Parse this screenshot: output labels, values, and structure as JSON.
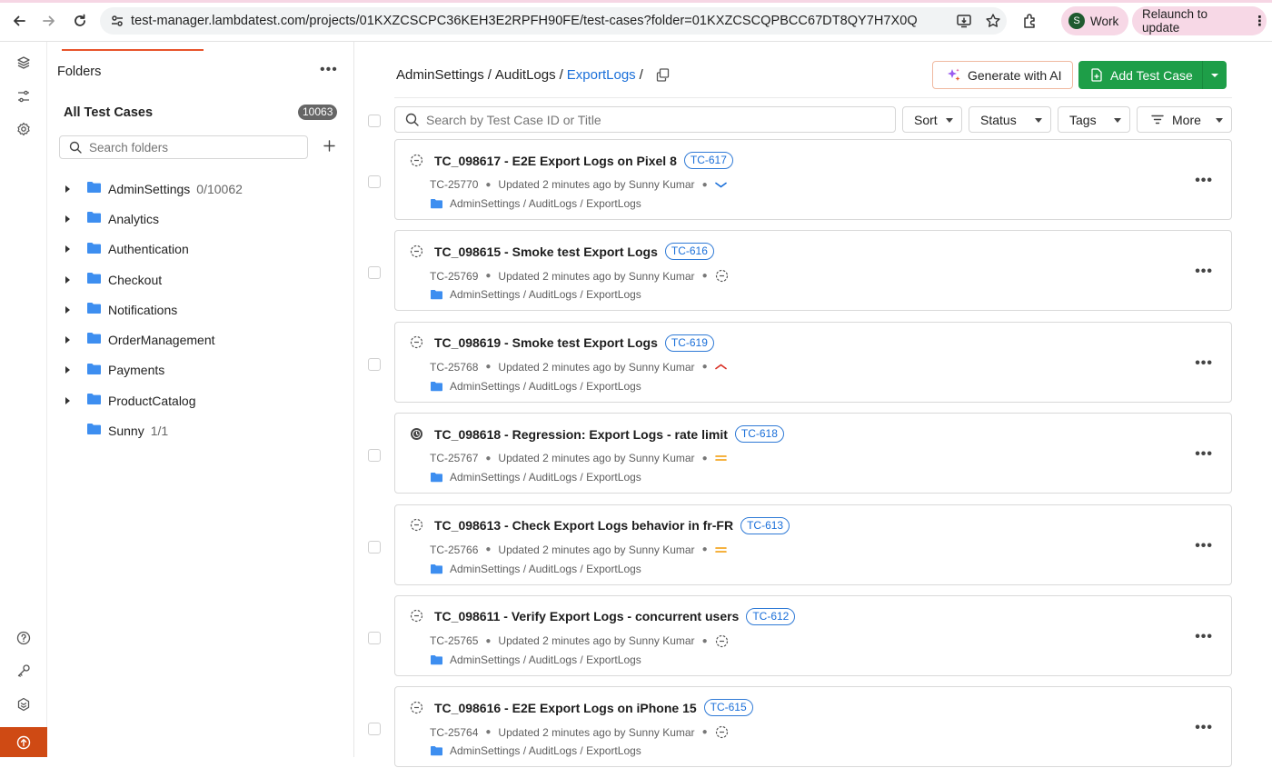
{
  "browser": {
    "url": "test-manager.lambdatest.com/projects/01KXZCSCPC36KEH3E2RPFH90FE/test-cases?folder=01KXZCSCQPBCC67DT8QY7H7X0Q",
    "profile_initial": "S",
    "profile_label": "Work",
    "relaunch_label": "Relaunch to update"
  },
  "folder_panel": {
    "title": "Folders",
    "all_test_cases_label": "All Test Cases",
    "all_test_cases_count": "10063",
    "search_placeholder": "Search folders",
    "folders": [
      {
        "name": "AdminSettings",
        "count": "0/10062",
        "expandable": true
      },
      {
        "name": "Analytics",
        "count": "",
        "expandable": true
      },
      {
        "name": "Authentication",
        "count": "",
        "expandable": true
      },
      {
        "name": "Checkout",
        "count": "",
        "expandable": true
      },
      {
        "name": "Notifications",
        "count": "",
        "expandable": true
      },
      {
        "name": "OrderManagement",
        "count": "",
        "expandable": true
      },
      {
        "name": "Payments",
        "count": "",
        "expandable": true
      },
      {
        "name": "ProductCatalog",
        "count": "",
        "expandable": true
      },
      {
        "name": "Sunny",
        "count": "1/1",
        "expandable": false
      }
    ]
  },
  "breadcrumb": {
    "parts": [
      "AdminSettings",
      "AuditLogs"
    ],
    "current": "ExportLogs",
    "separator": "/"
  },
  "actions": {
    "generate_ai_label": "Generate with AI",
    "add_test_case_label": "Add Test Case"
  },
  "toolbar": {
    "search_placeholder": "Search by Test Case ID or Title",
    "sort_label": "Sort",
    "status_label": "Status",
    "tags_label": "Tags",
    "more_label": "More"
  },
  "test_cases": [
    {
      "title": "TC_098617 - E2E Export Logs on Pixel 8",
      "tag": "TC-617",
      "id": "TC-25770",
      "updated": "Updated 2 minutes ago by Sunny Kumar",
      "priority": "low",
      "status": "draft",
      "path": "AdminSettings / AuditLogs / ExportLogs"
    },
    {
      "title": "TC_098615 - Smoke test Export Logs",
      "tag": "TC-616",
      "id": "TC-25769",
      "updated": "Updated 2 minutes ago by Sunny Kumar",
      "priority": "none",
      "status": "draft",
      "path": "AdminSettings / AuditLogs / ExportLogs"
    },
    {
      "title": "TC_098619 - Smoke test Export Logs",
      "tag": "TC-619",
      "id": "TC-25768",
      "updated": "Updated 2 minutes ago by Sunny Kumar",
      "priority": "high",
      "status": "draft",
      "path": "AdminSettings / AuditLogs / ExportLogs"
    },
    {
      "title": "TC_098618 - Regression: Export Logs - rate limit",
      "tag": "TC-618",
      "id": "TC-25767",
      "updated": "Updated 2 minutes ago by Sunny Kumar",
      "priority": "medium",
      "status": "scheduled",
      "path": "AdminSettings / AuditLogs / ExportLogs"
    },
    {
      "title": "TC_098613 - Check Export Logs behavior in fr-FR",
      "tag": "TC-613",
      "id": "TC-25766",
      "updated": "Updated 2 minutes ago by Sunny Kumar",
      "priority": "medium",
      "status": "draft",
      "path": "AdminSettings / AuditLogs / ExportLogs"
    },
    {
      "title": "TC_098611 - Verify Export Logs - concurrent users",
      "tag": "TC-612",
      "id": "TC-25765",
      "updated": "Updated 2 minutes ago by Sunny Kumar",
      "priority": "none",
      "status": "draft",
      "path": "AdminSettings / AuditLogs / ExportLogs"
    },
    {
      "title": "TC_098616 - E2E Export Logs on iPhone 15",
      "tag": "TC-615",
      "id": "TC-25764",
      "updated": "Updated 2 minutes ago by Sunny Kumar",
      "priority": "none",
      "status": "draft",
      "path": "AdminSettings / AuditLogs / ExportLogs"
    }
  ],
  "colors": {
    "accent_orange": "#e8542b",
    "primary_green": "#1e9e48",
    "link_blue": "#1a6fd9",
    "folder_blue": "#3d8ef0",
    "priority_low": "#1a6fd9",
    "priority_high": "#d93025",
    "priority_medium": "#f29900"
  }
}
